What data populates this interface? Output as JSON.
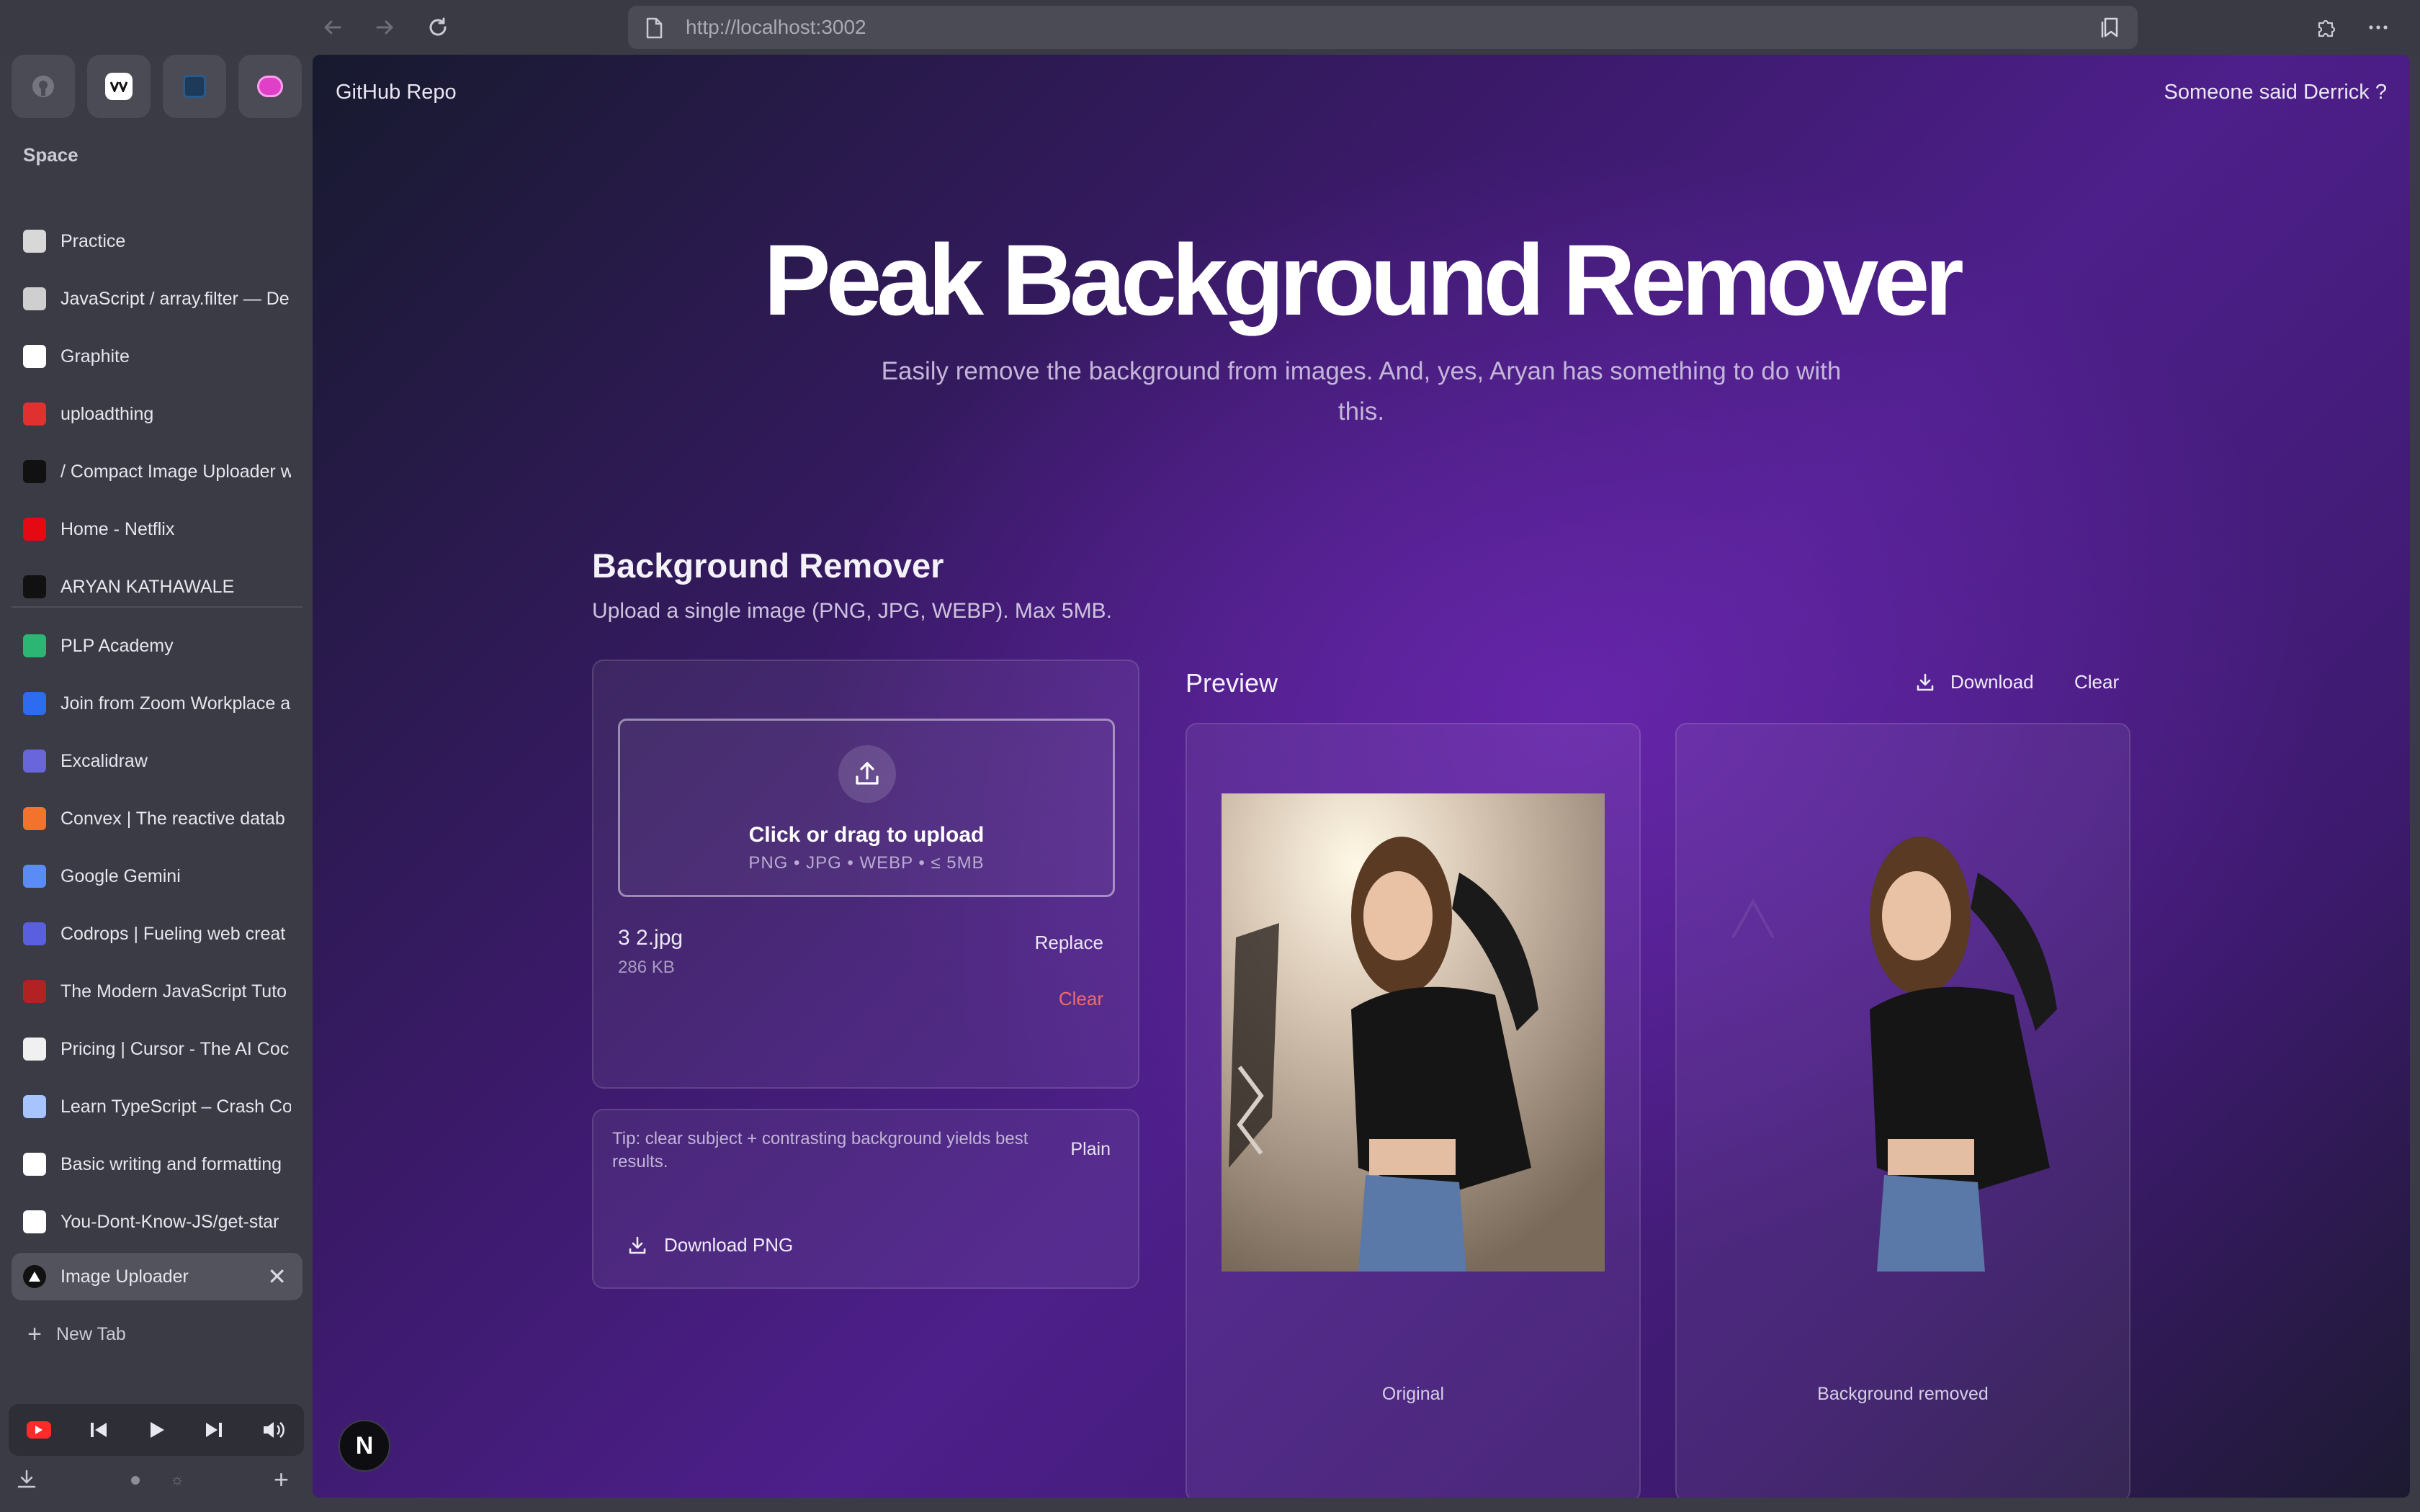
{
  "browser": {
    "url": "http://localhost:3002"
  },
  "sidebar": {
    "pinned": [
      {
        "icon": "github-icon"
      },
      {
        "icon": "vercel-icon"
      },
      {
        "icon": "docs-icon"
      },
      {
        "icon": "chat-icon"
      }
    ],
    "space_label": "Space",
    "tabs_top": [
      {
        "label": "Practice",
        "icon": "notebook-icon",
        "color": "#d8d8d8"
      },
      {
        "label": "JavaScript / array.filter — De",
        "icon": "mdn-icon",
        "color": "#cfcfcf"
      },
      {
        "label": "Graphite",
        "icon": "graphite-icon",
        "color": "#ffffff"
      },
      {
        "label": "uploadthing",
        "icon": "uploadthing-icon",
        "color": "#e03030"
      },
      {
        "label": "/  Compact Image Uploader w",
        "icon": "k-icon",
        "color": "#111111"
      },
      {
        "label": "Home - Netflix",
        "icon": "netflix-icon",
        "color": "#e50914"
      },
      {
        "label": "ARYAN KATHAWALE",
        "icon": "ak-icon",
        "color": "#111111"
      }
    ],
    "tabs_bottom": [
      {
        "label": "PLP Academy",
        "icon": "plp-icon",
        "color": "#2bb673"
      },
      {
        "label": "Join from Zoom Workplace a",
        "icon": "zoom-icon",
        "color": "#2d6cf0"
      },
      {
        "label": "Excalidraw",
        "icon": "excalidraw-icon",
        "color": "#6965db"
      },
      {
        "label": "Convex | The reactive datab",
        "icon": "convex-icon",
        "color": "#f3722c"
      },
      {
        "label": "Google Gemini",
        "icon": "gemini-icon",
        "color": "#5b8cf5"
      },
      {
        "label": "Codrops | Fueling web creat",
        "icon": "codrops-icon",
        "color": "#5a5fe0"
      },
      {
        "label": "The Modern JavaScript Tuto",
        "icon": "jsinfo-icon",
        "color": "#b22222"
      },
      {
        "label": "Pricing | Cursor - The AI Coc",
        "icon": "cursor-icon",
        "color": "#f0f0f0"
      },
      {
        "label": "Learn TypeScript – Crash Co",
        "icon": "typescript-icon",
        "color": "#a8c4ff"
      },
      {
        "label": "Basic writing and formatting",
        "icon": "github-icon",
        "color": "#ffffff"
      },
      {
        "label": "You-Dont-Know-JS/get-star",
        "icon": "github-icon",
        "color": "#ffffff"
      }
    ],
    "active_tab": {
      "label": "Image Uploader",
      "icon": "triangle-icon"
    },
    "new_tab_label": "New Tab"
  },
  "page": {
    "github_link": "GitHub Repo",
    "derrick_link": "Someone said Derrick ?",
    "hero_title": "Peak Background Remover",
    "hero_subtitle": "Easily remove the background from images. And, yes, Aryan has something to do with this.",
    "section_title": "Background Remover",
    "section_subtitle": "Upload a single image (PNG, JPG, WEBP). Max 5MB.",
    "upload": {
      "title": "Click or drag to upload",
      "hint": "PNG • JPG • WEBP • ≤ 5MB",
      "file_name": "3 2.jpg",
      "file_size": "286 KB",
      "replace_label": "Replace",
      "clear_label": "Clear"
    },
    "tip": {
      "text": "Tip: clear subject + contrasting background yields best results.",
      "plain_label": "Plain",
      "download_png_label": "Download PNG"
    },
    "preview": {
      "title": "Preview",
      "download_label": "Download",
      "clear_label": "Clear",
      "original_caption": "Original",
      "removed_caption": "Background removed"
    },
    "next_badge": "N"
  },
  "colors": {
    "accent_purple": "#4d1f8a",
    "danger": "#ef6b6b",
    "sidebar_bg": "#3a3b44"
  }
}
